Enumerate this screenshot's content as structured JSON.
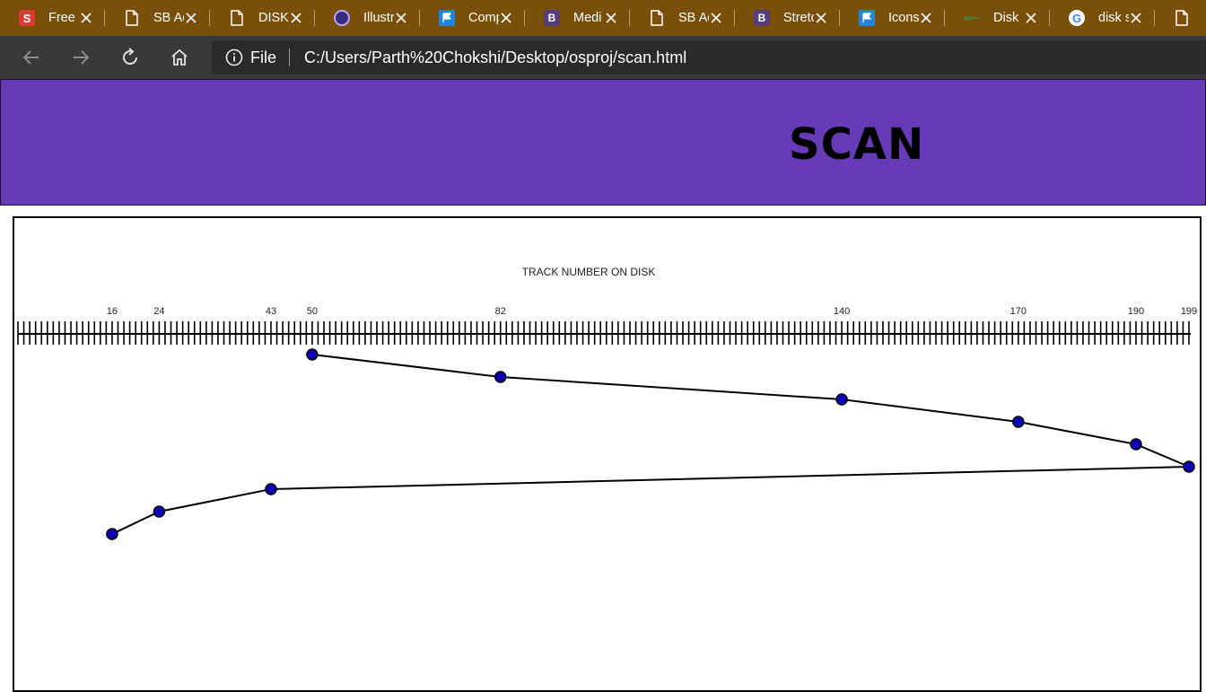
{
  "browser": {
    "tabs": [
      {
        "title": "Free I",
        "favicon": "s-logo-icon"
      },
      {
        "title": "SB Ac",
        "favicon": "page-icon"
      },
      {
        "title": "DISK",
        "favicon": "page-icon"
      },
      {
        "title": "Illustr",
        "favicon": "circle-logo-icon"
      },
      {
        "title": "Comp",
        "favicon": "flag-icon"
      },
      {
        "title": "Medi",
        "favicon": "bootstrap-icon"
      },
      {
        "title": "SB Ac",
        "favicon": "page-icon"
      },
      {
        "title": "Stretc",
        "favicon": "bootstrap-icon"
      },
      {
        "title": "Icons",
        "favicon": "flag-icon"
      },
      {
        "title": "Disk",
        "favicon": "strike-icon"
      },
      {
        "title": "disk s",
        "favicon": "google-icon"
      },
      {
        "title": "",
        "favicon": "page-icon"
      }
    ],
    "address": {
      "scheme": "File",
      "url": "C:/Users/Parth%20Chokshi/Desktop/osproj/scan.html"
    }
  },
  "page": {
    "title": "SCAN",
    "colors": {
      "banner": "#673ab7",
      "point": "#0a00b4",
      "line": "#000000"
    }
  },
  "chart_data": {
    "type": "line",
    "title": "TRACK NUMBER ON DISK",
    "axis_position": "top",
    "xlim": [
      0,
      199
    ],
    "tick_labels": [
      16,
      24,
      43,
      50,
      82,
      140,
      170,
      190,
      199
    ],
    "minor_tick_step": 1,
    "sequence": [
      50,
      82,
      140,
      170,
      190,
      199,
      43,
      24,
      16
    ],
    "series": [
      {
        "values": [
          50,
          82,
          140,
          170,
          190,
          199,
          43,
          24,
          16
        ]
      }
    ]
  }
}
